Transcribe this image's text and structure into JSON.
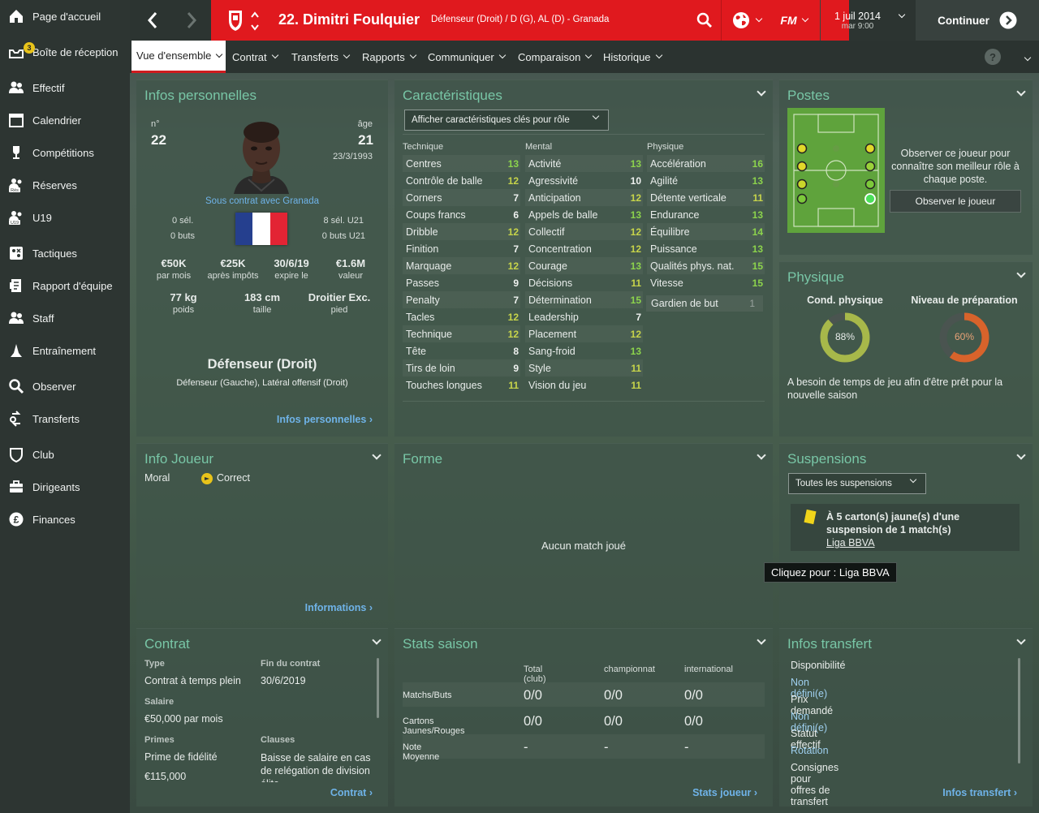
{
  "sidebar": {
    "items": [
      {
        "label": "Page d'accueil",
        "icon": "home-icon"
      },
      {
        "label": "Boîte de réception",
        "icon": "inbox-icon",
        "badge": "3"
      },
      {
        "label": "Effectif",
        "icon": "squad-icon"
      },
      {
        "label": "Calendrier",
        "icon": "calendar-icon"
      },
      {
        "label": "Compétitions",
        "icon": "trophy-icon"
      },
      {
        "label": "Réserves",
        "icon": "reserves-icon",
        "icon_text": "Rés"
      },
      {
        "label": "U19",
        "icon": "u19-icon",
        "icon_text": "U19"
      },
      {
        "label": "Tactiques",
        "icon": "tactics-icon"
      },
      {
        "label": "Rapport d'équipe",
        "icon": "report-icon"
      },
      {
        "label": "Staff",
        "icon": "staff-icon"
      },
      {
        "label": "Entraînement",
        "icon": "training-icon"
      },
      {
        "label": "Observer",
        "icon": "search-icon"
      },
      {
        "label": "Transferts",
        "icon": "transfers-icon"
      },
      {
        "label": "Club",
        "icon": "club-icon"
      },
      {
        "label": "Dirigeants",
        "icon": "board-icon"
      },
      {
        "label": "Finances",
        "icon": "finances-icon"
      }
    ]
  },
  "header": {
    "player_name": "22. Dimitri Foulquier",
    "positions": "Défenseur (Droit) / D (G), AL (D) - Granada",
    "fm_logo": "FM",
    "date": "1 juil 2014",
    "time": "mar 9:00",
    "continue_label": "Continuer",
    "red_color": "#e0191e"
  },
  "tabs": [
    "Vue d'ensemble",
    "Contrat",
    "Transferts",
    "Rapports",
    "Communiquer",
    "Comparaison",
    "Historique"
  ],
  "help_label": "?",
  "personal": {
    "title": "Infos personnelles",
    "number_label": "n°",
    "number": "22",
    "age_label": "âge",
    "age": "21",
    "dob": "23/3/1993",
    "contract_with": "Sous contrat avec Granada",
    "caps": "0 sél.",
    "goals": "0 buts",
    "u21_caps": "8 sél. U21",
    "u21_goals": "0 buts U21",
    "wage": "€50K",
    "wage_label": "par mois",
    "after_tax": "€25K",
    "after_tax_label": "après impôts",
    "expires": "30/6/19",
    "expires_label": "expire le",
    "value": "€1.6M",
    "value_label": "valeur",
    "weight": "77 kg",
    "weight_label": "poids",
    "height": "183 cm",
    "height_label": "taille",
    "foot": "Droitier Exc.",
    "foot_label": "pied",
    "main_position": "Défenseur (Droit)",
    "other_positions": "Défenseur (Gauche), Latéral offensif (Droit)",
    "link": "Infos personnelles"
  },
  "attributes": {
    "title": "Caractéristiques",
    "dropdown": "Afficher caractéristiques clés pour rôle",
    "technical_header": "Technique",
    "mental_header": "Mental",
    "physical_header": "Physique",
    "technical": [
      {
        "name": "Centres",
        "value": "13"
      },
      {
        "name": "Contrôle de balle",
        "value": "12"
      },
      {
        "name": "Corners",
        "value": "7"
      },
      {
        "name": "Coups francs",
        "value": "6"
      },
      {
        "name": "Dribble",
        "value": "12"
      },
      {
        "name": "Finition",
        "value": "7"
      },
      {
        "name": "Marquage",
        "value": "12"
      },
      {
        "name": "Passes",
        "value": "9"
      },
      {
        "name": "Penalty",
        "value": "7"
      },
      {
        "name": "Tacles",
        "value": "12"
      },
      {
        "name": "Technique",
        "value": "12"
      },
      {
        "name": "Tête",
        "value": "8"
      },
      {
        "name": "Tirs de loin",
        "value": "9"
      },
      {
        "name": "Touches longues",
        "value": "11"
      }
    ],
    "mental": [
      {
        "name": "Activité",
        "value": "13"
      },
      {
        "name": "Agressivité",
        "value": "10"
      },
      {
        "name": "Anticipation",
        "value": "12"
      },
      {
        "name": "Appels de balle",
        "value": "13"
      },
      {
        "name": "Collectif",
        "value": "12"
      },
      {
        "name": "Concentration",
        "value": "12"
      },
      {
        "name": "Courage",
        "value": "13"
      },
      {
        "name": "Décisions",
        "value": "11"
      },
      {
        "name": "Détermination",
        "value": "15"
      },
      {
        "name": "Leadership",
        "value": "7"
      },
      {
        "name": "Placement",
        "value": "12"
      },
      {
        "name": "Sang-froid",
        "value": "13"
      },
      {
        "name": "Style",
        "value": "11"
      },
      {
        "name": "Vision du jeu",
        "value": "11"
      }
    ],
    "physical": [
      {
        "name": "Accélération",
        "value": "16"
      },
      {
        "name": "Agilité",
        "value": "13"
      },
      {
        "name": "Détente verticale",
        "value": "11"
      },
      {
        "name": "Endurance",
        "value": "13"
      },
      {
        "name": "Équilibre",
        "value": "14"
      },
      {
        "name": "Puissance",
        "value": "13"
      },
      {
        "name": "Qualités phys. nat.",
        "value": "15"
      },
      {
        "name": "Vitesse",
        "value": "15"
      }
    ],
    "goalkeeping": {
      "name": "Gardien de but",
      "value": "1"
    }
  },
  "positions_panel": {
    "title": "Postes",
    "text": "Observer ce joueur pour connaître son meilleur rôle à chaque poste.",
    "button": "Observer le joueur"
  },
  "physique": {
    "title": "Physique",
    "condition_label": "Cond. physique",
    "condition": "88%",
    "condition_value": 0.88,
    "condition_color": "#a7b84a",
    "fitness_label": "Niveau de préparation",
    "fitness": "60%",
    "fitness_value": 0.6,
    "fitness_color": "#d8632b",
    "note": "A besoin de temps de jeu afin d'être prêt pour la nouvelle saison"
  },
  "player_info": {
    "title": "Info Joueur",
    "morale_label": "Moral",
    "morale": "Correct",
    "link": "Informations"
  },
  "form": {
    "title": "Forme",
    "empty": "Aucun match joué"
  },
  "suspensions": {
    "title": "Suspensions",
    "dropdown": "Toutes les suspensions",
    "item_text": "À 5 carton(s) jaune(s) d'une suspension de 1 match(s)",
    "competition": "Liga BBVA",
    "tooltip": "Cliquez pour : Liga BBVA"
  },
  "contract": {
    "title": "Contrat",
    "type_label": "Type",
    "type": "Contrat à temps plein",
    "end_label": "Fin du contrat",
    "end": "30/6/2019",
    "wage_label": "Salaire",
    "wage": "€50,000 par mois",
    "bonus_label": "Primes",
    "bonus_name": "Prime de fidélité",
    "bonus_value": "€115,000",
    "clauses_label": "Clauses",
    "clause": "Baisse de salaire en cas de relégation de division élite",
    "link": "Contrat"
  },
  "season_stats": {
    "title": "Stats saison",
    "columns": [
      "Total (club)",
      "championnat",
      "international"
    ],
    "rows": [
      {
        "label": "Matchs/Buts",
        "values": [
          "0/0",
          "0/0",
          "0/0"
        ]
      },
      {
        "label": "Cartons Jaunes/Rouges",
        "values": [
          "0/0",
          "0/0",
          "0/0"
        ]
      },
      {
        "label": "Note Moyenne",
        "values": [
          "-",
          "-",
          "-"
        ]
      }
    ],
    "link": "Stats joueur"
  },
  "transfer_info": {
    "title": "Infos transfert",
    "items": [
      {
        "label": "Disponibilité",
        "value": "Non défini(e)"
      },
      {
        "label": "Prix demandé",
        "value": "Non défini(e)"
      },
      {
        "label": "Statut effectif",
        "value": "Rotation"
      },
      {
        "label": "Consignes pour offres de transfert",
        "value": ""
      }
    ],
    "link": "Infos transfert"
  }
}
